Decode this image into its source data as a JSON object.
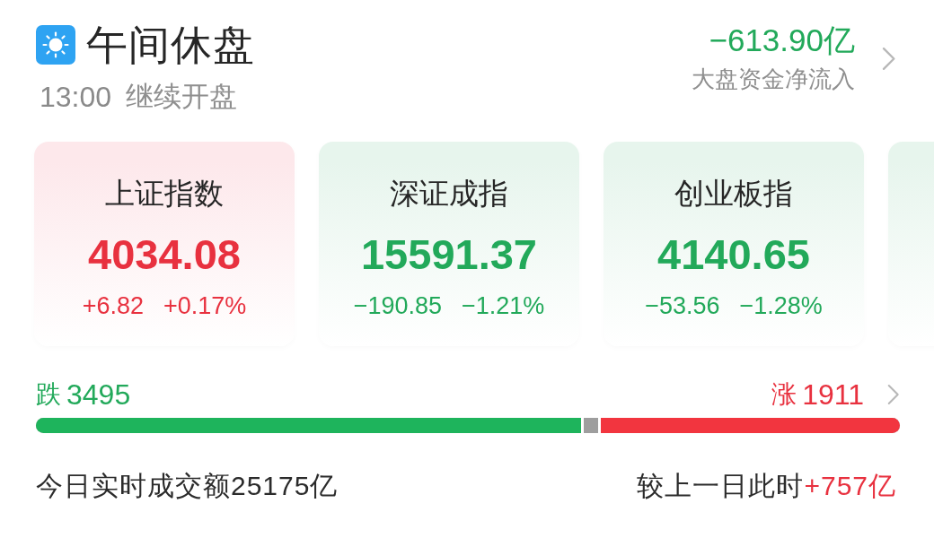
{
  "status": {
    "title": "午间休盘",
    "time": "13:00",
    "note": "继续开盘"
  },
  "net_flow": {
    "value": "−613.90亿",
    "label": "大盘资金净流入"
  },
  "cards": [
    {
      "kind": "up",
      "name": "上证指数",
      "value": "4034.08",
      "change": "+6.82",
      "percent": "+0.17%",
      "color": "#e8313f"
    },
    {
      "kind": "down",
      "name": "深证成指",
      "value": "15591.37",
      "change": "−190.85",
      "percent": "−1.21%",
      "color": "#22a95a"
    },
    {
      "kind": "down",
      "name": "创业板指",
      "value": "4140.65",
      "change": "−53.56",
      "percent": "−1.28%",
      "color": "#22a95a"
    },
    {
      "kind": "down"
    }
  ],
  "breadth": {
    "falling": {
      "label": "跌",
      "count": "3495",
      "level": 0.631
    },
    "rising": {
      "label": "涨",
      "count": "1911",
      "level": 0.346
    }
  },
  "turnover": {
    "label": "今日实时成交额",
    "value": "25175亿",
    "compare_label": "较上一日此时",
    "compare_value": "+757亿"
  }
}
